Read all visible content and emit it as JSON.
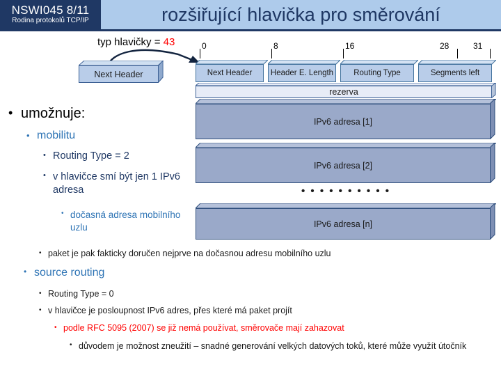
{
  "header": {
    "course_code": "NSWI045   8/11",
    "course_sub": "Rodina protokolů TCP/IP",
    "title": "rozšiřující hlavička pro směrování"
  },
  "annotation": {
    "label": "typ hlavičky = ",
    "value": "43",
    "value_color": "#ff0000"
  },
  "diagram": {
    "prev_box_label": "Next Header",
    "ruler_ticks": [
      {
        "label": "0",
        "bit": 0
      },
      {
        "label": "8",
        "bit": 8
      },
      {
        "label": "16",
        "bit": 16
      },
      {
        "label": "28",
        "bit": 28
      },
      {
        "label": "31",
        "bit": 31
      }
    ],
    "fields": [
      {
        "label": "Next Header"
      },
      {
        "label": "Header E. Length"
      },
      {
        "label": "Routing Type"
      },
      {
        "label": "Segments left"
      }
    ],
    "reserved_label": "rezerva",
    "address_rows": [
      {
        "label": "IPv6 adresa [1]"
      },
      {
        "label": "IPv6 adresa [2]"
      },
      {
        "label": "IPv6 adresa [n]"
      }
    ],
    "ellipsis": "• • • • • • • • • •"
  },
  "bullets": {
    "b1": "umožnuje:",
    "b2": "mobilitu",
    "b3": "Routing Type = 2",
    "b4": "v hlavičce smí být jen 1 IPv6 adresa",
    "b5": "dočasná adresa mobilního uzlu",
    "b6": "paket je pak fakticky doručen nejprve na dočasnou adresu mobilního uzlu",
    "b7": "source routing",
    "b8": "Routing Type = 0",
    "b9": "v hlavičce je posloupnost IPv6 adres, přes které má paket projít",
    "b10": "podle RFC 5095 (2007) se již nemá používat, směrovače mají zahazovat",
    "b11": "důvodem je možnost zneužití – snadné generování velkých datových toků, které může využít útočník",
    "bullet_glyph": "•"
  }
}
